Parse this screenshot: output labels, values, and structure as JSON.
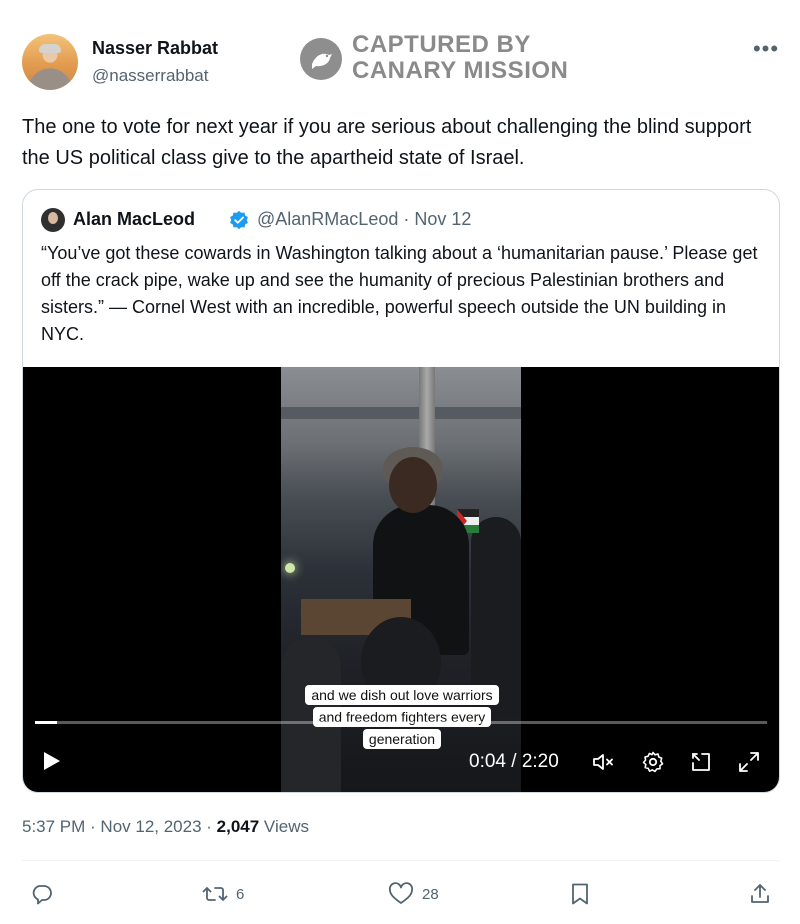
{
  "author": {
    "name": "Nasser Rabbat",
    "handle": "@nasserrabbat",
    "avatar_icon": "profile-photo"
  },
  "watermark": {
    "line1": "CAPTURED BY",
    "line2": "CANARY MISSION",
    "icon": "canary-bird-icon"
  },
  "more_icon": "•••",
  "tweet": {
    "text": "The one to vote for next year if you are serious about challenging the blind support the US political class give to the apartheid state of Israel."
  },
  "quote": {
    "name": "Alan MacLeod",
    "verified": true,
    "handle_date": "@AlanRMacLeod · Nov 12",
    "text": "“You’ve got these cowards in Washington talking about a ‘humanitarian pause.’ Please get off the crack pipe, wake up and see the humanity of precious Palestinian brothers and sisters.”  — Cornel West with an incredible, powerful speech outside the UN building in NYC."
  },
  "video": {
    "caption_lines": [
      "and we dish out love warriors",
      "and freedom fighters every",
      "generation"
    ],
    "time": "0:04 / 2:20",
    "progress_fraction": 0.03,
    "controls": [
      "play-icon",
      "mute-icon",
      "settings-icon",
      "picture-in-picture-icon",
      "fullscreen-icon"
    ]
  },
  "meta": {
    "time_date": "5:37 PM · Nov 12, 2023 · ",
    "views_count": "2,047",
    "views_label": " Views"
  },
  "actions": {
    "reply_count": "",
    "retweet_count": "6",
    "like_count": "28"
  },
  "colors": {
    "verified": "#1d9bf0",
    "secondary_text": "#536471",
    "border": "#cfd9de"
  }
}
